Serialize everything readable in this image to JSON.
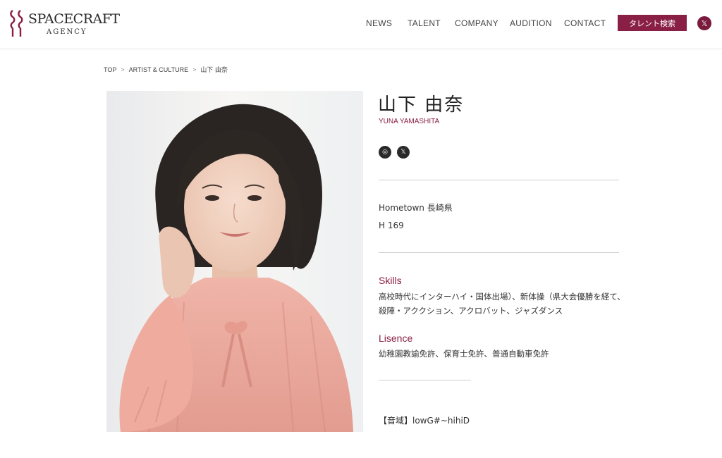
{
  "header": {
    "logo_text": "SPACECRAFT",
    "logo_sub": "AGENCY",
    "nav": [
      "NEWS",
      "TALENT",
      "COMPANY",
      "AUDITION",
      "CONTACT"
    ],
    "search_label": "タレント検索",
    "x_icon_glyph": "𝕏",
    "brand_color": "#8a1f45"
  },
  "breadcrumb": {
    "items": [
      "TOP",
      "ARTIST & CULTURE",
      "山下 由奈"
    ],
    "separator": ">"
  },
  "profile": {
    "name_jp": "山下 由奈",
    "name_en": "YUNA YAMASHITA",
    "social": [
      "instagram-icon",
      "x-icon"
    ],
    "instagram_glyph": "◎",
    "x_glyph": "𝕏",
    "hometown": "Hometown 長崎県",
    "height": "H 169",
    "skills_title": "Skills",
    "skills_line1": "高校時代にインターハイ・国体出場）、新体操（県大会優勝を経て、",
    "skills_line2": "殺陣・アククション、アクロバット、ジャズダンス",
    "licence_title": "Lisence",
    "licence_body": "幼稚園教諭免許、保育士免許、普通自動車免許",
    "voice_range": "【音域】lowG#~hihiD"
  }
}
